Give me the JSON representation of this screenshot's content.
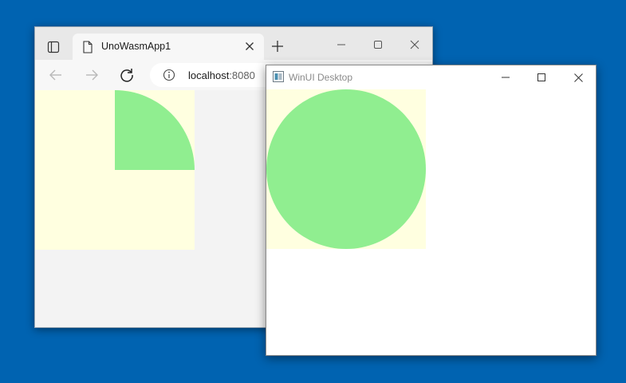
{
  "colors": {
    "desktop": "#0063b1",
    "square_fill": "#ffffe0",
    "shape_fill": "#90ee90"
  },
  "browser": {
    "tab": {
      "title": "UnoWasmApp1",
      "icon": "page-icon"
    },
    "toolbar": {
      "url_host": "localhost",
      "url_port": ":8080"
    },
    "shape": "quarter-circle"
  },
  "winui": {
    "title": "WinUI Desktop",
    "shape": "circle"
  }
}
